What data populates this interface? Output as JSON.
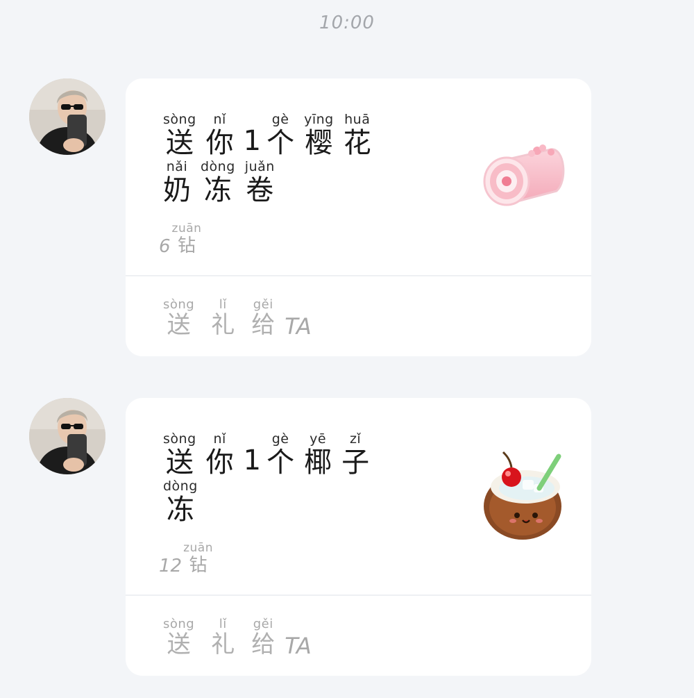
{
  "time": "10:00",
  "messages": [
    {
      "title": [
        {
          "char": "送",
          "pinyin": "sòng"
        },
        {
          "char": "你",
          "pinyin": "nǐ"
        },
        {
          "digit": "1"
        },
        {
          "char": "个",
          "pinyin": "gè"
        },
        {
          "char": "樱",
          "pinyin": "yīng"
        },
        {
          "char": "花",
          "pinyin": "huā"
        }
      ],
      "title2": [
        {
          "char": "奶",
          "pinyin": "nǎi"
        },
        {
          "char": "冻",
          "pinyin": "dòng"
        },
        {
          "char": "卷",
          "pinyin": "juǎn"
        }
      ],
      "price": {
        "number": "6",
        "unit": "钻",
        "unit_pinyin": "zuān"
      },
      "gift_icon": "sakura-milk-jelly-roll-icon",
      "action": {
        "words": [
          {
            "char": "送",
            "pinyin": "sòng"
          },
          {
            "char": "礼",
            "pinyin": "lǐ"
          },
          {
            "char": "给",
            "pinyin": "gěi"
          }
        ],
        "suffix": "TA"
      }
    },
    {
      "title": [
        {
          "char": "送",
          "pinyin": "sòng"
        },
        {
          "char": "你",
          "pinyin": "nǐ"
        },
        {
          "digit": "1"
        },
        {
          "char": "个",
          "pinyin": "gè"
        },
        {
          "char": "椰",
          "pinyin": "yē"
        },
        {
          "char": "子",
          "pinyin": "zǐ"
        }
      ],
      "title2": [
        {
          "char": "冻",
          "pinyin": "dòng"
        }
      ],
      "price": {
        "number": "12",
        "unit": "钻",
        "unit_pinyin": "zuān"
      },
      "gift_icon": "coconut-jelly-icon",
      "action": {
        "words": [
          {
            "char": "送",
            "pinyin": "sòng"
          },
          {
            "char": "礼",
            "pinyin": "lǐ"
          },
          {
            "char": "给",
            "pinyin": "gěi"
          }
        ],
        "suffix": "TA"
      }
    }
  ]
}
